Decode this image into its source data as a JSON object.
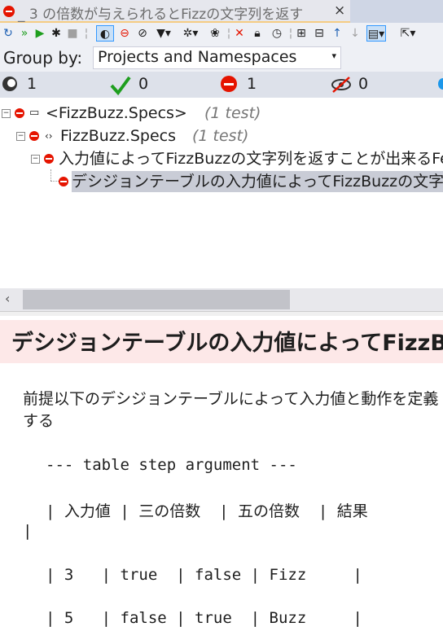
{
  "tab": {
    "title": "_ 3 の倍数が与えられるとFizzの文字列を返す",
    "close": "×"
  },
  "toolbar": {
    "icons": [
      "refresh-icon",
      "run-all-icon",
      "run-icon",
      "debug-icon",
      "stop-icon",
      "track-icon",
      "stop-fail-icon",
      "hide-icon",
      "filter-icon",
      "settings-icon",
      "paw-icon",
      "close-icon",
      "lock-icon",
      "clock-icon",
      "expand-icon",
      "collapse-icon",
      "up-icon",
      "down-icon",
      "output-icon",
      "export-icon"
    ]
  },
  "group_by": {
    "label": "Group by:",
    "value": "Projects and Namespaces"
  },
  "stats": {
    "total": "1",
    "passed": "0",
    "failed": "1",
    "ignored": "0"
  },
  "tree": {
    "project": {
      "name": "<FizzBuzz.Specs>",
      "count": "(1 test)"
    },
    "namespace": {
      "name": "FizzBuzz.Specs",
      "count": "(1 test)"
    },
    "feature": {
      "name": "入力値によってFizzBuzzの文字列を返すことが出来るFeature"
    },
    "test": {
      "name": "デシジョンテーブルの入力値によってFizzBuzzの文字列を返す"
    }
  },
  "detail": {
    "title": "デシジョンテーブルの入力値によってFizzBuzzの文字列を返す",
    "description": "前提以下のデシジョンテーブルによって入力値と動作を定義する",
    "table_header": "--- table step argument ---",
    "table_columns_line": "| 入力値 | 三の倍数  | 五の倍数  | 結果",
    "table_columns_end": "|",
    "rows": [
      "| 3   | true  | false | Fizz     |",
      "| 5   | false | true  | Buzz     |"
    ]
  },
  "colors": {
    "fail": "#e51400",
    "pass": "#1e9e1e",
    "accent": "#f5cc84"
  }
}
